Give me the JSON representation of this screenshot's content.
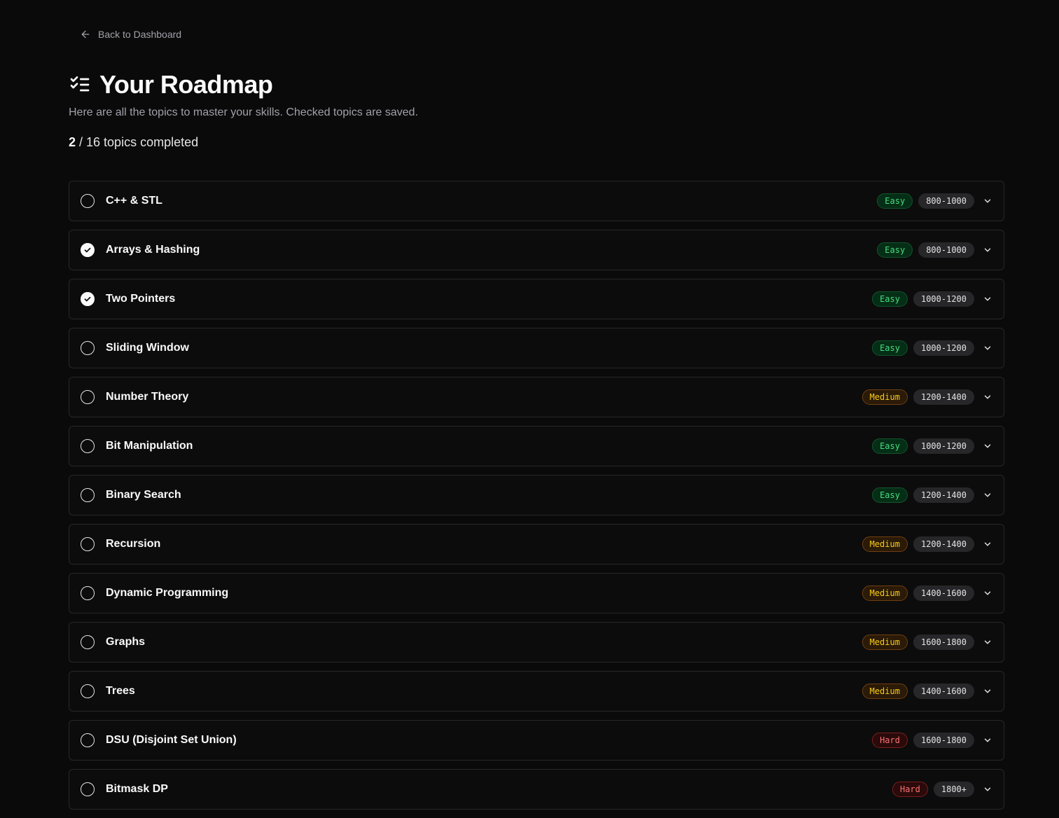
{
  "nav": {
    "back_label": "Back to Dashboard"
  },
  "header": {
    "title": "Your Roadmap",
    "subtitle": "Here are all the topics to master your skills. Checked topics are saved."
  },
  "progress": {
    "completed": "2",
    "rest": " / 16 topics completed"
  },
  "colors": {
    "background": "#0a0a0a",
    "easy": "#4ade80",
    "medium": "#facc15",
    "hard": "#f87171"
  },
  "topics": [
    {
      "name": "C++ & STL",
      "difficulty": "Easy",
      "rating": "800-1000",
      "checked": false
    },
    {
      "name": "Arrays & Hashing",
      "difficulty": "Easy",
      "rating": "800-1000",
      "checked": true
    },
    {
      "name": "Two Pointers",
      "difficulty": "Easy",
      "rating": "1000-1200",
      "checked": true
    },
    {
      "name": "Sliding Window",
      "difficulty": "Easy",
      "rating": "1000-1200",
      "checked": false
    },
    {
      "name": "Number Theory",
      "difficulty": "Medium",
      "rating": "1200-1400",
      "checked": false
    },
    {
      "name": "Bit Manipulation",
      "difficulty": "Easy",
      "rating": "1000-1200",
      "checked": false
    },
    {
      "name": "Binary Search",
      "difficulty": "Easy",
      "rating": "1200-1400",
      "checked": false
    },
    {
      "name": "Recursion",
      "difficulty": "Medium",
      "rating": "1200-1400",
      "checked": false
    },
    {
      "name": "Dynamic Programming",
      "difficulty": "Medium",
      "rating": "1400-1600",
      "checked": false
    },
    {
      "name": "Graphs",
      "difficulty": "Medium",
      "rating": "1600-1800",
      "checked": false
    },
    {
      "name": "Trees",
      "difficulty": "Medium",
      "rating": "1400-1600",
      "checked": false
    },
    {
      "name": "DSU (Disjoint Set Union)",
      "difficulty": "Hard",
      "rating": "1600-1800",
      "checked": false
    },
    {
      "name": "Bitmask DP",
      "difficulty": "Hard",
      "rating": "1800+",
      "checked": false
    }
  ]
}
